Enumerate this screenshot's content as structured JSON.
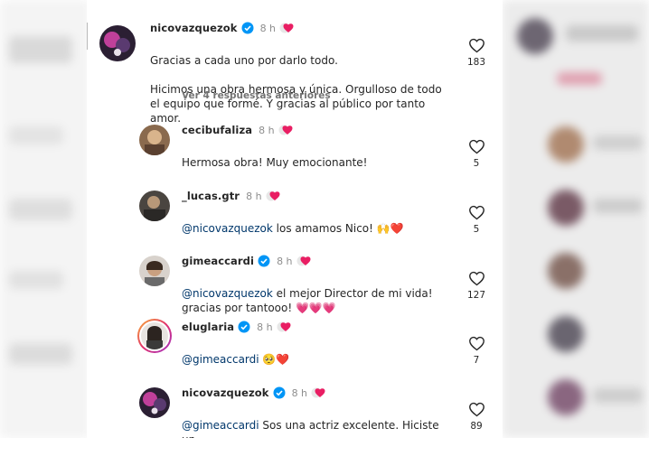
{
  "colors": {
    "text": "#262626",
    "secondary": "#8e8e8e",
    "mention": "#00376b",
    "verified": "#0095f6",
    "heart_pink": "#e91e63"
  },
  "top_comment": {
    "username": "nicovazquezok",
    "time": "8 h",
    "verified": true,
    "line1": "Gracias a cada uno por darlo todo.",
    "line2": "Hicimos una obra hermosa y única. Orgulloso de todo el equipo que formé. Y gracias al público por tanto amor.",
    "emoji": "💕",
    "likes": "183"
  },
  "view_replies": "Ver 4 respuestas anteriores",
  "replies": [
    {
      "username": "cecibufaliza",
      "verified": false,
      "time": "8 h",
      "mention": "",
      "text": "Hermosa obra! Muy emocionante!",
      "likes": "5"
    },
    {
      "username": "_lucas.gtr",
      "verified": false,
      "time": "8 h",
      "mention": "@nicovazquezok",
      "text": " los amamos Nico! 🙌❤️",
      "likes": "5"
    },
    {
      "username": "gimeaccardi",
      "verified": true,
      "time": "8 h",
      "mention": "@nicovazquezok",
      "text": " el mejor Director de mi vida!\ngracias por tantooo! 💗💗💗",
      "likes": "127"
    },
    {
      "username": "eluglaria",
      "verified": true,
      "time": "8 h",
      "mention": "@gimeaccardi",
      "text": " 🥺❤️",
      "likes": "7"
    },
    {
      "username": "nicovazquezok",
      "verified": true,
      "time": "8 h",
      "mention": "@gimeaccardi",
      "text": " Sos una actriz excelente. Hiciste un\ntrabajo espectacular. ❤️🎭👏",
      "likes": "89"
    }
  ],
  "icons": {
    "like": "heart-outline-icon",
    "verified": "verified-badge-icon",
    "creator_liked": "creator-liked-heart-icon"
  }
}
